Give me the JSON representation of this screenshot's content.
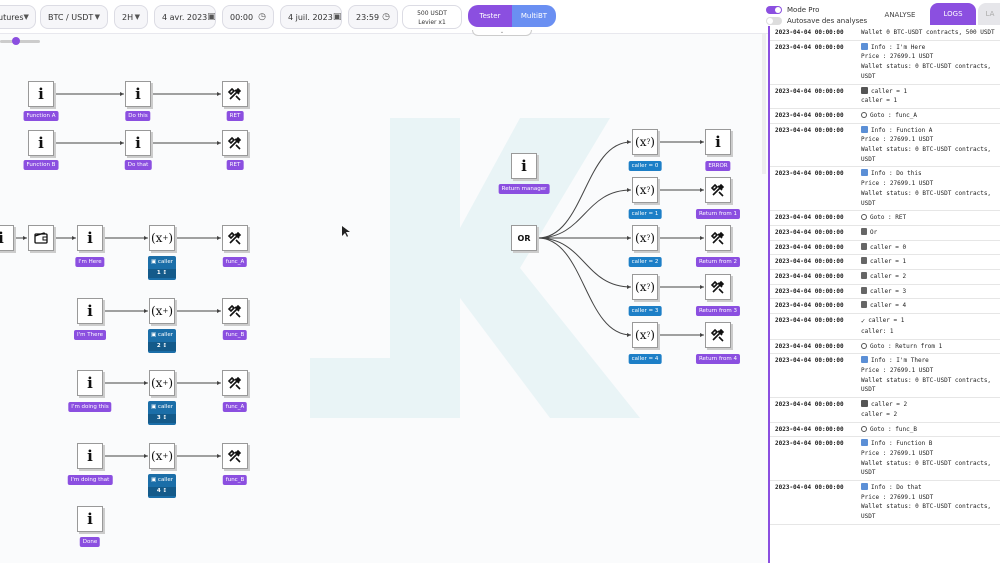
{
  "toolbar": {
    "market": "utures",
    "pair": "BTC / USDT",
    "timeframe": "2H",
    "start_date": "4 avr. 2023",
    "start_time": "00:00",
    "end_date": "4 juil. 2023",
    "end_time": "23:59",
    "wallet_amount": "500 USDT",
    "wallet_leverage": "Levier x1",
    "tester_label": "Tester",
    "multibt_label": "MultiBT"
  },
  "right_header": {
    "mode_pro": "Mode Pro",
    "autosave": "Autosave des analyses",
    "tab_analyse": "ANALYSE",
    "tab_logs": "LOGS",
    "tab_extra": "LA"
  },
  "nodes": {
    "fa": "Function A",
    "do_this": "Do this",
    "ret1": "RET",
    "fb": "Function B",
    "do_that": "Do that",
    "ret2": "RET",
    "im_here": "I'm Here",
    "func_a1": "func_A",
    "im_there": "I'm There",
    "func_b1": "func_B",
    "doing_this": "I'm doing this",
    "func_a2": "func_A",
    "doing_that": "I'm doing that",
    "func_b2": "func_B",
    "done": "Done",
    "return_manager": "Return manager",
    "or": "OR",
    "c0": "caller = 0",
    "c1": "caller = 1",
    "c2": "caller = 2",
    "c3": "caller = 3",
    "c4": "caller = 4",
    "error": "ERROR",
    "rf1": "Return from 1",
    "rf2": "Return from 2",
    "rf3": "Return from 3",
    "rf4": "Return from 4",
    "caller_lbl": "caller",
    "cv1": "1 ↕",
    "cv2": "2 ↕",
    "cv3": "3 ↕",
    "cv4": "4 ↕"
  },
  "logs": [
    {
      "time": "2023-04-04 00:00:00",
      "icon": "",
      "msg": "Wallet 0 BTC-USDT contracts, 500 USDT"
    },
    {
      "time": "2023-04-04 00:00:00",
      "icon": "info",
      "msg": "Info : I'm Here\nPrice : 27699.1 USDT\nWallet status: 0 BTC-USDT contracts,\nUSDT"
    },
    {
      "time": "2023-04-04 00:00:00",
      "icon": "save",
      "msg": "caller = 1\ncaller = 1"
    },
    {
      "time": "2023-04-04 00:00:00",
      "icon": "goto",
      "msg": "Goto : func_A"
    },
    {
      "time": "2023-04-04 00:00:00",
      "icon": "info",
      "msg": "Info : Function A\nPrice : 27699.1 USDT\nWallet status: 0 BTC-USDT contracts,\nUSDT"
    },
    {
      "time": "2023-04-04 00:00:00",
      "icon": "info",
      "msg": "Info : Do this\nPrice : 27699.1 USDT\nWallet status: 0 BTC-USDT contracts,\nUSDT"
    },
    {
      "time": "2023-04-04 00:00:00",
      "icon": "goto",
      "msg": "Goto : RET"
    },
    {
      "time": "2023-04-04 00:00:00",
      "icon": "var",
      "msg": "Or"
    },
    {
      "time": "2023-04-04 00:00:00",
      "icon": "var",
      "msg": "caller = 0"
    },
    {
      "time": "2023-04-04 00:00:00",
      "icon": "var",
      "msg": "caller = 1"
    },
    {
      "time": "2023-04-04 00:00:00",
      "icon": "var",
      "msg": "caller = 2"
    },
    {
      "time": "2023-04-04 00:00:00",
      "icon": "var",
      "msg": "caller = 3"
    },
    {
      "time": "2023-04-04 00:00:00",
      "icon": "var",
      "msg": "caller = 4"
    },
    {
      "time": "2023-04-04 00:00:00",
      "icon": "check",
      "msg": "caller = 1\ncaller: 1"
    },
    {
      "time": "2023-04-04 00:00:00",
      "icon": "goto",
      "msg": "Goto : Return from 1"
    },
    {
      "time": "2023-04-04 00:00:00",
      "icon": "info",
      "msg": "Info : I'm There\nPrice : 27699.1 USDT\nWallet status: 0 BTC-USDT contracts,\nUSDT"
    },
    {
      "time": "2023-04-04 00:00:00",
      "icon": "save",
      "msg": "caller = 2\ncaller = 2"
    },
    {
      "time": "2023-04-04 00:00:00",
      "icon": "goto",
      "msg": "Goto : func_B"
    },
    {
      "time": "2023-04-04 00:00:00",
      "icon": "info",
      "msg": "Info : Function B\nPrice : 27699.1 USDT\nWallet status: 0 BTC-USDT contracts,\nUSDT"
    },
    {
      "time": "2023-04-04 00:00:00",
      "icon": "info",
      "msg": "Info : Do that\nPrice : 27699.1 USDT\nWallet status: 0 BTC-USDT contracts,\nUSDT"
    }
  ],
  "colors": {
    "accent": "#8b4fe0",
    "blue_label": "#1d7fc7",
    "multibt": "#6a8ff2"
  }
}
